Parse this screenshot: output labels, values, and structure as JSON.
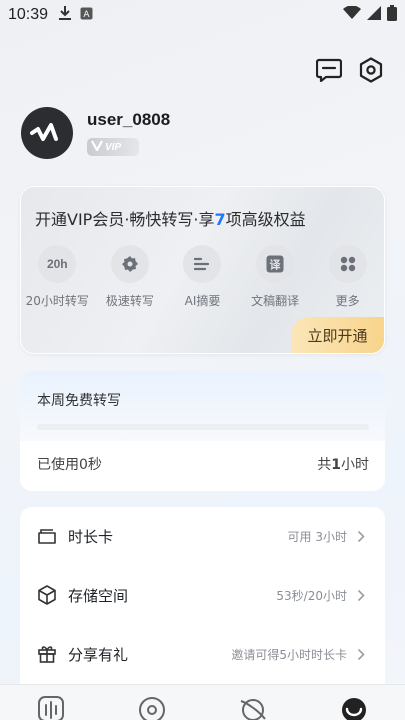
{
  "status_bar": {
    "time": "10:39",
    "icons": [
      "download-icon",
      "notification-a-icon"
    ],
    "right_icons": [
      "wifi-icon",
      "signal-icon",
      "battery-icon"
    ]
  },
  "header": {
    "actions": [
      "message-icon",
      "settings-icon"
    ]
  },
  "profile": {
    "username": "user_0808",
    "vip_badge": "VIP"
  },
  "vip_card": {
    "title_prefix": "开通VIP会员·畅快转写·享",
    "title_highlight": "7",
    "title_suffix": "项高级权益",
    "benefits": [
      {
        "icon_text": "20h",
        "label": "20小时转写"
      },
      {
        "icon_text": "",
        "label": "极速转写"
      },
      {
        "icon_text": "",
        "label": "AI摘要"
      },
      {
        "icon_text": "译",
        "label": "文稿翻译"
      },
      {
        "icon_text": "",
        "label": "更多"
      }
    ],
    "open_label": "立即开通"
  },
  "free_card": {
    "title": "本周免费转写",
    "used_label": "已使用0秒",
    "total_prefix": "共",
    "total_number": "1",
    "total_suffix": "小时",
    "progress": 0
  },
  "menu": {
    "items": [
      {
        "label": "时长卡",
        "value": "可用 3小时"
      },
      {
        "label": "存储空间",
        "value": "53秒/20小时"
      },
      {
        "label": "分享有礼",
        "value": "邀请可得5小时时长卡"
      }
    ]
  },
  "tabs": [
    "waveform-icon",
    "record-icon",
    "planet-icon",
    "profile-icon"
  ],
  "colors": {
    "accent": "#1e78ff",
    "vip_button": "#f8d48c",
    "avatar_bg": "#2b2d31"
  }
}
